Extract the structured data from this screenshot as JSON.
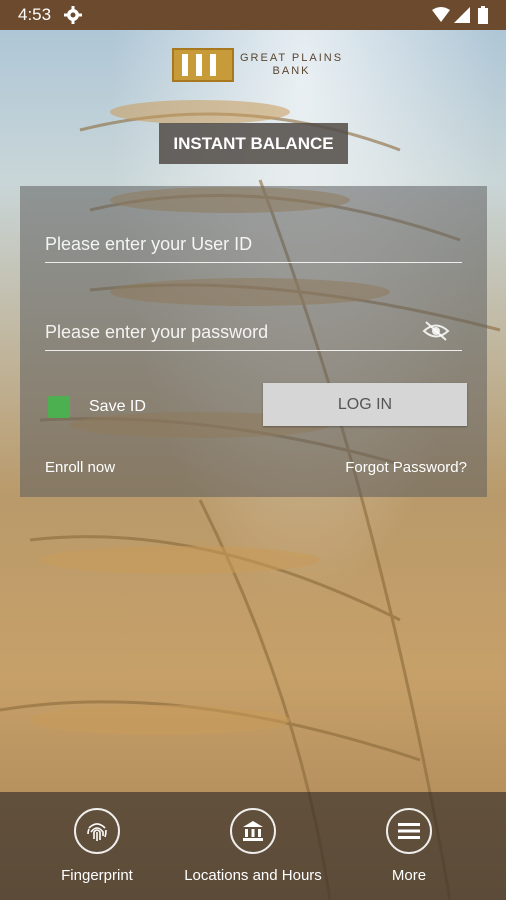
{
  "status_bar": {
    "time": "4:53"
  },
  "logo": {
    "line1": "GREAT PLAINS",
    "line2": "BANK"
  },
  "instant_balance": {
    "label": "INSTANT BALANCE"
  },
  "login_form": {
    "user_id_placeholder": "Please enter your User ID",
    "password_placeholder": "Please enter your password",
    "save_id_label": "Save ID",
    "save_id_checked": true,
    "login_label": "LOG IN",
    "enroll_label": "Enroll now",
    "forgot_label": "Forgot Password?"
  },
  "bottom_nav": {
    "fingerprint": {
      "label": "Fingerprint",
      "icon": "fingerprint-icon"
    },
    "locations": {
      "label": "Locations and Hours",
      "icon": "bank-icon"
    },
    "more": {
      "label": "More",
      "icon": "menu-icon"
    }
  },
  "colors": {
    "status_bar": "#6b4a2d",
    "checkbox": "#4caf50",
    "logo_gold": "#c79a3a"
  }
}
